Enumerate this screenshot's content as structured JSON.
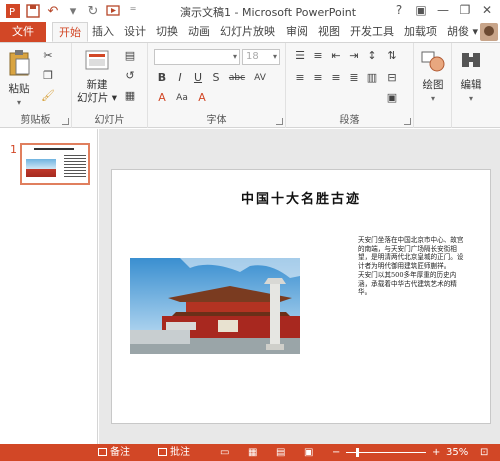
{
  "window": {
    "title": "演示文稿1 - Microsoft PowerPoint",
    "controls": [
      "?",
      "▣",
      "—",
      "❐",
      "✕"
    ]
  },
  "qat": {
    "save_icon": "save-icon",
    "undo_icon": "undo-icon",
    "redo_icon": "redo-icon",
    "customize_icon": "start-from-beginning-icon"
  },
  "tabs": [
    {
      "label": "文件",
      "key": "file"
    },
    {
      "label": "开始",
      "key": "home",
      "active": true
    },
    {
      "label": "插入",
      "key": "insert"
    },
    {
      "label": "设计",
      "key": "design"
    },
    {
      "label": "切换",
      "key": "transitions"
    },
    {
      "label": "动画",
      "key": "animations"
    },
    {
      "label": "幻灯片放映",
      "key": "slideshow"
    },
    {
      "label": "审阅",
      "key": "review"
    },
    {
      "label": "视图",
      "key": "view"
    },
    {
      "label": "开发工具",
      "key": "developer"
    },
    {
      "label": "加载项",
      "key": "addins"
    }
  ],
  "user": {
    "name": "胡俊 ▾"
  },
  "ribbon": {
    "clipboard": {
      "label": "剪贴板",
      "paste": "粘贴"
    },
    "slides": {
      "label": "幻灯片",
      "new_slide": "新建",
      "new_slide_2": "幻灯片 ▾"
    },
    "font": {
      "label": "字体",
      "size": "18"
    },
    "paragraph": {
      "label": "段落"
    },
    "drawing": {
      "label": "绘图"
    },
    "editing": {
      "label": "编辑"
    }
  },
  "thumbnails": {
    "number": "1"
  },
  "slide": {
    "title": "中国十大名胜古迹",
    "text": [
      "天安门坐落在中国北京市中心、故宫的南端，与天安门广场隔长安街相望，是明清两代北京皇城的正门。设计者为明代御用建筑匠师蒯祥。",
      "天安门以其500多年厚重的历史内涵，承载着中华古代建筑艺术的精华。"
    ]
  },
  "status": {
    "notes": "备注",
    "comments": "批注",
    "zoom_label": "35%",
    "zoom": 0.35
  },
  "colors": {
    "accent": "#d24726",
    "ribbon_bg": "#f7f7f7"
  }
}
